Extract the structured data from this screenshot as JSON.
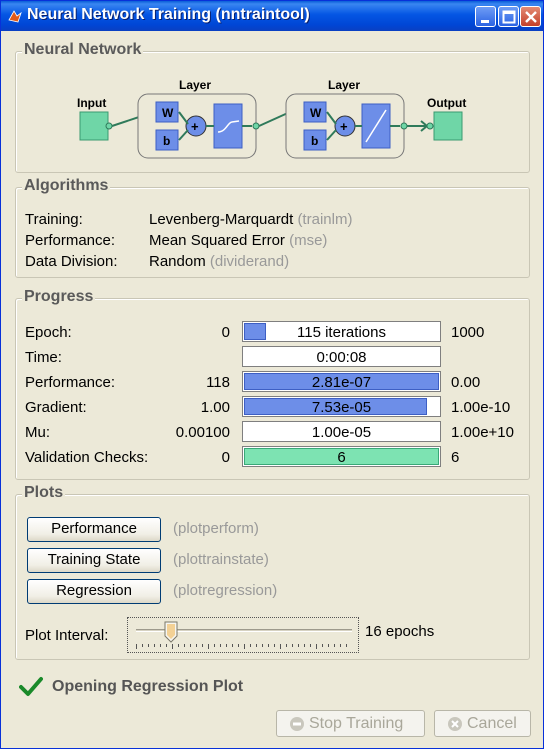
{
  "window": {
    "title": "Neural Network Training (nntraintool)"
  },
  "network": {
    "section_title": "Neural Network",
    "input_label": "Input",
    "output_label": "Output",
    "layer1_label": "Layer",
    "layer2_label": "Layer",
    "w_label": "W",
    "b_label": "b",
    "plus": "+"
  },
  "algorithms": {
    "section_title": "Algorithms",
    "rows": [
      {
        "label": "Training:",
        "value": "Levenberg-Marquardt",
        "fn": "(trainlm)"
      },
      {
        "label": "Performance:",
        "value": "Mean Squared Error",
        "fn": "(mse)"
      },
      {
        "label": "Data Division:",
        "value": "Random",
        "fn": "(dividerand)"
      }
    ]
  },
  "progress": {
    "section_title": "Progress",
    "rows": [
      {
        "label": "Epoch:",
        "start": "0",
        "bar_text": "115 iterations",
        "end": "1000",
        "fill": 0.115,
        "fill_style": "blue"
      },
      {
        "label": "Time:",
        "start": "",
        "bar_text": "0:00:08",
        "end": "",
        "fill": 0,
        "fill_style": "none"
      },
      {
        "label": "Performance:",
        "start": "118",
        "bar_text": "2.81e-07",
        "end": "0.00",
        "fill": 1.0,
        "fill_style": "blue"
      },
      {
        "label": "Gradient:",
        "start": "1.00",
        "bar_text": "7.53e-05",
        "end": "1.00e-10",
        "fill": 0.94,
        "fill_style": "blue"
      },
      {
        "label": "Mu:",
        "start": "0.00100",
        "bar_text": "1.00e-05",
        "end": "1.00e+10",
        "fill": 0,
        "fill_style": "none"
      },
      {
        "label": "Validation Checks:",
        "start": "0",
        "bar_text": "6",
        "end": "6",
        "fill": 1.0,
        "fill_style": "green"
      }
    ]
  },
  "plots": {
    "section_title": "Plots",
    "buttons": [
      {
        "label": "Performance",
        "fn": "(plotperform)"
      },
      {
        "label": "Training State",
        "fn": "(plottrainstate)"
      },
      {
        "label": "Regression",
        "fn": "(plotregression)"
      }
    ],
    "interval_label": "Plot Interval:",
    "interval_value": "16 epochs",
    "slider_fraction": 0.16
  },
  "status": {
    "text": "Opening Regression Plot"
  },
  "footer": {
    "stop_label": "Stop Training",
    "cancel_label": "Cancel"
  },
  "colors": {
    "titlebar": "#0456e4",
    "bar_fill": "#6d8ee8",
    "validation_fill": "#7de3b2",
    "node": "#6fd6a7"
  }
}
